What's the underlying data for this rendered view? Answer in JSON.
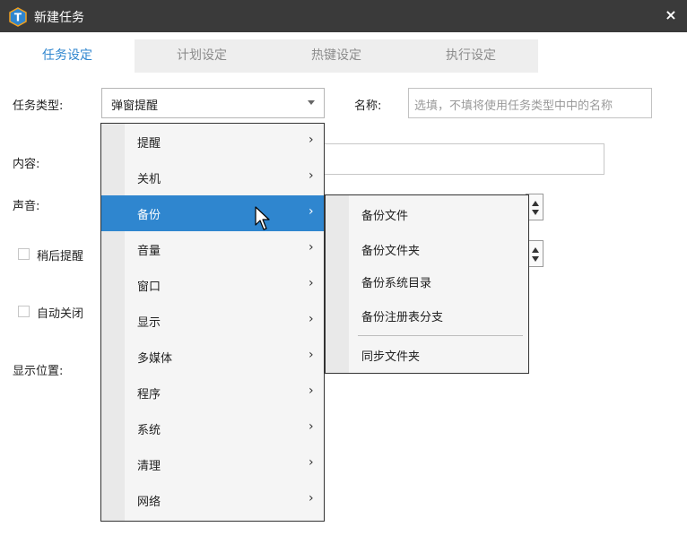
{
  "window": {
    "title": "新建任务",
    "close_label": "×",
    "logo_letter": "T",
    "logo_icon": "app-logo-icon",
    "close_icon": "close-icon"
  },
  "tabs": [
    {
      "label": "任务设定",
      "active": true
    },
    {
      "label": "计划设定",
      "active": false
    },
    {
      "label": "热键设定",
      "active": false
    },
    {
      "label": "执行设定",
      "active": false
    }
  ],
  "form": {
    "task_type_label": "任务类型:",
    "task_type_value": "弹窗提醒",
    "name_label": "名称:",
    "name_placeholder": "选填，不填将使用任务类型中中的名称",
    "content_label": "内容:",
    "sound_label": "声音:",
    "snooze_label": "稍后提醒",
    "auto_close_label": "自动关闭",
    "position_label": "显示位置:"
  },
  "menu": {
    "items": [
      {
        "label": "提醒",
        "arrow": "›"
      },
      {
        "label": "关机",
        "arrow": "›"
      },
      {
        "label": "备份",
        "arrow": "›",
        "highlighted": true
      },
      {
        "label": "音量",
        "arrow": "›"
      },
      {
        "label": "窗口",
        "arrow": "›"
      },
      {
        "label": "显示",
        "arrow": "›"
      },
      {
        "label": "多媒体",
        "arrow": "›"
      },
      {
        "label": "程序",
        "arrow": "›"
      },
      {
        "label": "系统",
        "arrow": "›"
      },
      {
        "label": "清理",
        "arrow": "›"
      },
      {
        "label": "网络",
        "arrow": "›"
      }
    ]
  },
  "submenu": {
    "items": [
      "备份文件",
      "备份文件夹",
      "备份系统目录",
      "备份注册表分支"
    ],
    "after_separator": "同步文件夹"
  },
  "colors": {
    "accent": "#2f86cf",
    "titlebar": "#3a3a3a"
  }
}
